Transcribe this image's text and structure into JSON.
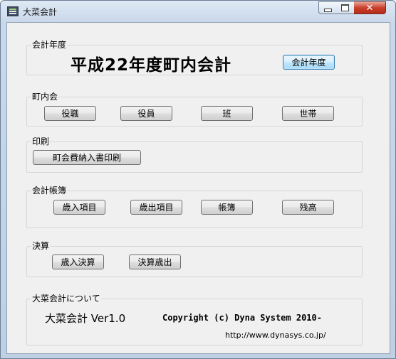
{
  "window": {
    "title": "大菜会計",
    "minimize_icon": "minimize-icon",
    "maximize_icon": "maximize-icon",
    "close_icon": "close-icon"
  },
  "fiscal_year": {
    "label": "会計年度",
    "heading": "平成22年度町内会計",
    "button": "会計年度"
  },
  "neighborhood": {
    "label": "町内会",
    "buttons": [
      "役職",
      "役員",
      "班",
      "世帯"
    ]
  },
  "printing": {
    "label": "印刷",
    "button": "町会費納入書印刷"
  },
  "ledger": {
    "label": "会計帳簿",
    "buttons": [
      "歳入項目",
      "歳出項目",
      "帳簿",
      "残高"
    ]
  },
  "settlement": {
    "label": "決算",
    "buttons": [
      "歳入決算",
      "決算歳出"
    ]
  },
  "about": {
    "label": "大菜会計について",
    "product": "大菜会計 Ver1.0",
    "copyright": "Copyright (c) Dyna System 2010-",
    "url": "http://www.dynasys.co.jp/"
  }
}
